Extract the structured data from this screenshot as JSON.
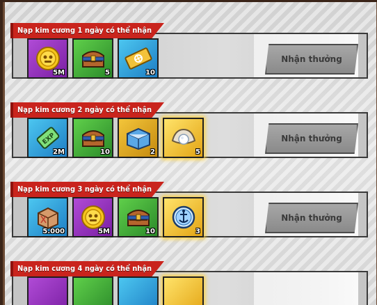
{
  "rows": [
    {
      "label": "Nạp kim cương 1 ngày có thể nhận",
      "claim": "Nhận thưởng",
      "items": [
        {
          "icon": "gold-coin-icon",
          "qty": "5M"
        },
        {
          "icon": "treasure-chest-icon",
          "qty": "5"
        },
        {
          "icon": "golden-ticket-icon",
          "qty": "10"
        }
      ]
    },
    {
      "label": "Nạp kim cương 2 ngày có thể nhận",
      "claim": "Nhận thưởng",
      "items": [
        {
          "icon": "exp-ticket-icon",
          "qty": "2M"
        },
        {
          "icon": "treasure-chest-icon",
          "qty": "10"
        },
        {
          "icon": "blue-chest-icon",
          "qty": "2"
        },
        {
          "icon": "pearl-shell-icon",
          "qty": "5"
        }
      ]
    },
    {
      "label": "Nạp kim cương 3 ngày có thể nhận",
      "claim": "Nhận thưởng",
      "items": [
        {
          "icon": "wooden-crate-icon",
          "qty": "5.000"
        },
        {
          "icon": "gold-coin-icon",
          "qty": "5M"
        },
        {
          "icon": "treasure-chest-icon",
          "qty": "10"
        },
        {
          "icon": "anchor-compass-icon",
          "qty": "3"
        }
      ]
    },
    {
      "label": "Nạp kim cương 4 ngày có thể nhận",
      "claim": "",
      "items": []
    }
  ]
}
